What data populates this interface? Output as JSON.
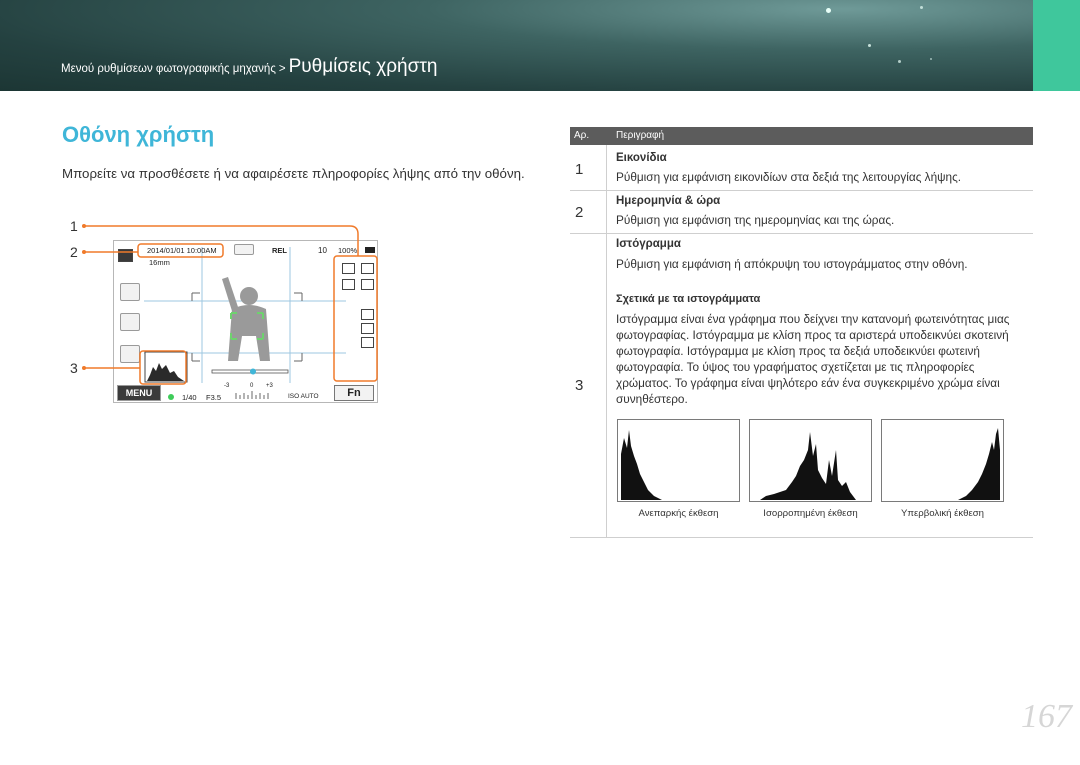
{
  "header": {
    "breadcrumb_parent": "Μενού ρυθμίσεων φωτογραφικής μηχανής",
    "breadcrumb_separator": ">",
    "breadcrumb_current": "Ρυθμίσεις χρήστη"
  },
  "section": {
    "title": "Οθόνη χρήστη",
    "intro": "Μπορείτε να προσθέσετε ή να αφαιρέσετε πληροφορίες λήψης από την οθόνη."
  },
  "illustration": {
    "callouts": [
      "1",
      "2",
      "3"
    ],
    "screen": {
      "datetime": "2014/01/01 10:00AM",
      "focal_length": "16mm",
      "shots_remaining": "10",
      "battery": "100%",
      "shutter": "1/40",
      "aperture": "F3.5",
      "ev_minus": "-3",
      "ev_zero": "0",
      "ev_plus": "+3",
      "iso": "ISO AUTO",
      "menu_label": "MENU",
      "fn_label": "Fn",
      "rel_label": "REL",
      "auto_label": "AUTO"
    }
  },
  "table": {
    "col_no": "Αρ.",
    "col_desc": "Περιγραφή",
    "rows": [
      {
        "num": "1",
        "head": "Εικονίδια",
        "desc": "Ρύθμιση για εμφάνιση εικονιδίων στα δεξιά της λειτουργίας λήψης."
      },
      {
        "num": "2",
        "head": "Ημερομηνία & ώρα",
        "desc": "Ρύθμιση για εμφάνιση της ημερομηνίας και της ώρας."
      },
      {
        "num": "3",
        "head": "Ιστόγραμμα",
        "desc": "Ρύθμιση για εμφάνιση ή απόκρυψη του ιστογράμματος στην οθόνη.",
        "subhead": "Σχετικά με τα ιστογράμματα",
        "subdesc": "Ιστόγραμμα είναι ένα γράφημα που δείχνει την κατανομή φωτεινότητας μιας φωτογραφίας. Ιστόγραμμα με κλίση προς τα αριστερά υποδεικνύει σκοτεινή φωτογραφία. Ιστόγραμμα με κλίση προς τα δεξιά υποδεικνύει φωτεινή φωτογραφία. Το ύψος του γραφήματος σχετίζεται με τις πληροφορίες χρώματος. Το γράφημα είναι ψηλότερο εάν ένα συγκεκριμένο χρώμα είναι συνηθέστερο.",
        "histograms": [
          {
            "caption": "Ανεπαρκής έκθεση",
            "skew": "left"
          },
          {
            "caption": "Ισορροπημένη έκθεση",
            "skew": "center"
          },
          {
            "caption": "Υπερβολική έκθεση",
            "skew": "right"
          }
        ]
      }
    ]
  },
  "page_number": "167",
  "colors": {
    "accent": "#3fb6d8",
    "callout": "#f07a2a",
    "banner_tab": "#3fc79c",
    "table_header": "#5c5c5c"
  }
}
